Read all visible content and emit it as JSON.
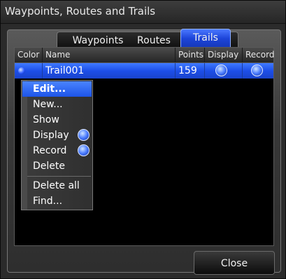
{
  "window": {
    "title": "Waypoints, Routes and Trails"
  },
  "tabs": [
    {
      "label": "Waypoints",
      "selected": false
    },
    {
      "label": "Routes",
      "selected": false
    },
    {
      "label": "Trails",
      "selected": true
    }
  ],
  "table": {
    "columns": [
      "Color",
      "Name",
      "Points",
      "Display",
      "Record"
    ],
    "rows": [
      {
        "color": "#2c5bff",
        "name": "Trail001",
        "points": "159",
        "display": true,
        "record": true
      }
    ]
  },
  "context_menu": {
    "items": [
      {
        "label": "Edit...",
        "active": true
      },
      {
        "label": "New...",
        "active": false
      },
      {
        "label": "Show",
        "active": false
      },
      {
        "label": "Display",
        "active": false,
        "toggle": true
      },
      {
        "label": "Record",
        "active": false,
        "toggle": true
      },
      {
        "label": "Delete",
        "active": false
      },
      {
        "label": "Delete all",
        "active": false
      },
      {
        "label": "Find...",
        "active": false
      }
    ]
  },
  "footer": {
    "close_label": "Close"
  },
  "colors": {
    "accent": "#1d4fe8",
    "background": "#2b2b2b"
  },
  "icons": {
    "toggle": "blue-orb-icon",
    "trail_color": "color-dot-icon"
  }
}
